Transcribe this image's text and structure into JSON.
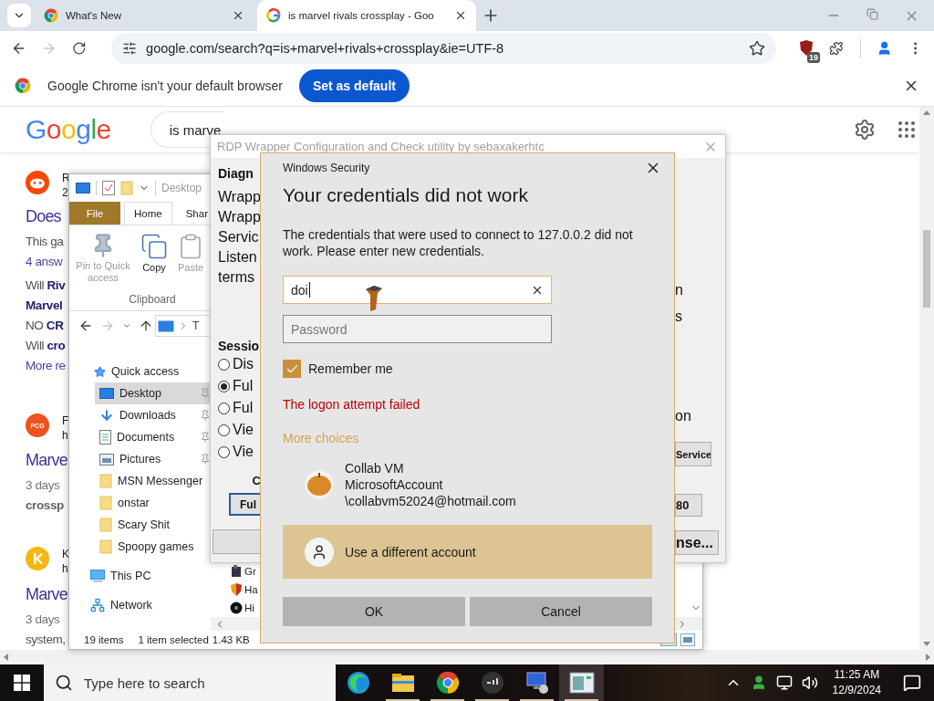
{
  "browser": {
    "tabs": [
      {
        "title": "What's New",
        "kind": "whatsnew",
        "selected": false
      },
      {
        "title": "is marvel rivals crossplay - Goo",
        "kind": "google",
        "selected": true
      }
    ],
    "forward_disabled": true,
    "address": "google.com/search?q=is+marvel+rivals+crossplay&ie=UTF-8",
    "extension_badge": "19",
    "infobar": {
      "message": "Google Chrome isn't your default browser",
      "button": "Set as default"
    }
  },
  "google": {
    "logo": "Google",
    "query": "is marve",
    "results": [
      {
        "kind": "reddit",
        "source": [
          "R",
          "2"
        ],
        "title": "Does",
        "lines": [
          {
            "kind": "snippet",
            "text": "This ga"
          },
          {
            "kind": "link",
            "text": "4 answ"
          },
          {
            "kind": "faq",
            "text": "Will **Riv**"
          },
          {
            "kind": "faq-title",
            "text": "Marvel"
          },
          {
            "kind": "faq",
            "text": "NO **CR**"
          },
          {
            "kind": "faq",
            "text": "Will **cro**"
          },
          {
            "kind": "link",
            "text": "More re"
          }
        ]
      },
      {
        "kind": "pcg",
        "icon_text": "PCG",
        "source": [
          "F",
          "h"
        ],
        "title": "Marve",
        "lines": [
          {
            "kind": "date",
            "text": "3 days"
          },
          {
            "kind": "bold-snippet",
            "text": "crossp"
          }
        ]
      },
      {
        "kind": "k",
        "source": [
          "K",
          "h"
        ],
        "title": "Marve",
        "lines": [
          {
            "kind": "date",
            "text": "3 days"
          },
          {
            "kind": "snippet",
            "text": "system,"
          }
        ]
      }
    ]
  },
  "explorer": {
    "title": "Desktop",
    "ribbon_tabs": [
      {
        "label": "File",
        "kind": "file",
        "selected": false
      },
      {
        "label": "Home",
        "kind": "tab",
        "selected": true
      },
      {
        "label": "Shar",
        "kind": "tab",
        "selected": false
      }
    ],
    "commands": [
      {
        "label": "Pin to Quick access",
        "kind": "pin",
        "disabled": true
      },
      {
        "label": "Copy",
        "kind": "copy",
        "disabled": false
      },
      {
        "label": "Paste",
        "kind": "paste",
        "disabled": true
      }
    ],
    "group": "Clipboard",
    "path": "T",
    "nav": [
      {
        "label": "Quick access",
        "kind": "quick",
        "selected": false,
        "pinned": false,
        "children": [
          {
            "label": "Desktop",
            "kind": "desktop",
            "selected": true,
            "pinned": true
          },
          {
            "label": "Downloads",
            "kind": "downloads",
            "selected": false,
            "pinned": true
          },
          {
            "label": "Documents",
            "kind": "documents",
            "selected": false,
            "pinned": true
          },
          {
            "label": "Pictures",
            "kind": "pictures",
            "selected": false,
            "pinned": true
          },
          {
            "label": "MSN Messenger",
            "kind": "folder",
            "selected": false,
            "pinned": false
          },
          {
            "label": "onstar",
            "kind": "folder",
            "selected": false,
            "pinned": false
          },
          {
            "label": "Scary Shit",
            "kind": "folder",
            "selected": false,
            "pinned": false
          },
          {
            "label": "Spoopy games",
            "kind": "folder",
            "selected": false,
            "pinned": false
          }
        ]
      },
      {
        "label": "This PC",
        "kind": "pc",
        "selected": false,
        "pinned": false
      },
      {
        "label": "Network",
        "kind": "network",
        "selected": false,
        "pinned": false
      }
    ],
    "files": [
      {
        "name": "Gr",
        "kind": "app"
      },
      {
        "name": "Ha",
        "kind": "shield"
      },
      {
        "name": "Hi",
        "kind": "disc"
      }
    ],
    "status": [
      "19 items",
      "1 item selected",
      "1.43 KB"
    ]
  },
  "rdp": {
    "title": "RDP Wrapper Configuration and Check utility by sebaxakerhtc",
    "diagnostics_label": "Diagn",
    "diagnostics_lines": [
      "Wrapp",
      "Wrapp",
      "Servic",
      "Listen",
      "terms"
    ],
    "session_label": "Sessio",
    "session_options": [
      {
        "label": "Dis",
        "selected": false
      },
      {
        "label": "Ful",
        "selected": true
      },
      {
        "label": "Ful",
        "selected": false
      },
      {
        "label": "Vie",
        "selected": false
      },
      {
        "label": "Vie",
        "selected": false
      }
    ],
    "port_label": "C",
    "mode_button": "Ful",
    "right_lines": [
      "n",
      "s"
    ],
    "right_status": "on",
    "service_button": "Service",
    "port_value": "80",
    "license_button": "nse..."
  },
  "dialog": {
    "title": "Windows Security",
    "heading": "Your credentials did not work",
    "message": "The credentials that were used to connect to 127.0.0.2 did not work. Please enter new credentials.",
    "username": "doi",
    "password_placeholder": "Password",
    "remember": {
      "label": "Remember me",
      "checked": true
    },
    "error": "The logon attempt failed",
    "more_choices": "More choices",
    "accounts": [
      {
        "kind": "saved",
        "lines": [
          "Collab VM",
          "MicrosoftAccount",
          "\\collabvm52024@hotmail.com"
        ],
        "selected": false
      },
      {
        "kind": "other",
        "lines": [
          "Use a different account"
        ],
        "selected": true
      }
    ],
    "buttons": [
      "OK",
      "Cancel"
    ]
  },
  "taskbar": {
    "search_placeholder": "Type here to search",
    "apps": [
      {
        "kind": "edge",
        "running": false,
        "selected": false
      },
      {
        "kind": "folder",
        "running": true,
        "selected": false
      },
      {
        "kind": "chrome",
        "running": true,
        "selected": false
      },
      {
        "kind": "terminal",
        "running": true,
        "selected": false
      },
      {
        "kind": "rdp",
        "running": true,
        "selected": false
      },
      {
        "kind": "config",
        "running": true,
        "selected": true
      }
    ],
    "time": "11:25 AM",
    "date": "12/9/2024"
  }
}
